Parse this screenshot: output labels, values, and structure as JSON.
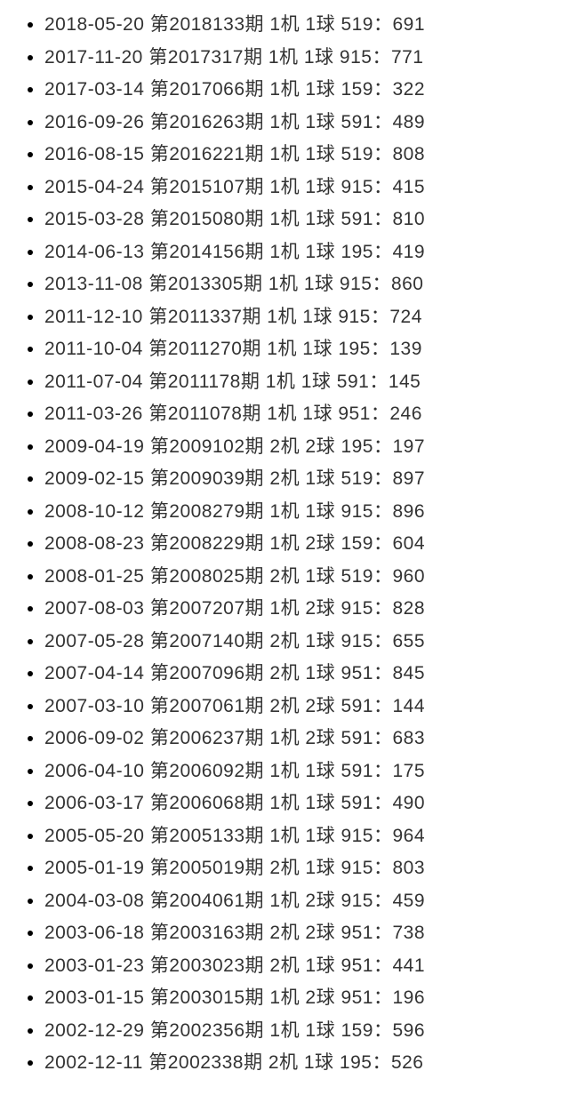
{
  "entries": [
    {
      "date": "2018-05-20",
      "issue": "2018133",
      "machine": "1",
      "ball": "1",
      "numA": "519",
      "numB": "691"
    },
    {
      "date": "2017-11-20",
      "issue": "2017317",
      "machine": "1",
      "ball": "1",
      "numA": "915",
      "numB": "771"
    },
    {
      "date": "2017-03-14",
      "issue": "2017066",
      "machine": "1",
      "ball": "1",
      "numA": "159",
      "numB": "322"
    },
    {
      "date": "2016-09-26",
      "issue": "2016263",
      "machine": "1",
      "ball": "1",
      "numA": "591",
      "numB": "489"
    },
    {
      "date": "2016-08-15",
      "issue": "2016221",
      "machine": "1",
      "ball": "1",
      "numA": "519",
      "numB": "808"
    },
    {
      "date": "2015-04-24",
      "issue": "2015107",
      "machine": "1",
      "ball": "1",
      "numA": "915",
      "numB": "415"
    },
    {
      "date": "2015-03-28",
      "issue": "2015080",
      "machine": "1",
      "ball": "1",
      "numA": "591",
      "numB": "810"
    },
    {
      "date": "2014-06-13",
      "issue": "2014156",
      "machine": "1",
      "ball": "1",
      "numA": "195",
      "numB": "419"
    },
    {
      "date": "2013-11-08",
      "issue": "2013305",
      "machine": "1",
      "ball": "1",
      "numA": "915",
      "numB": "860"
    },
    {
      "date": "2011-12-10",
      "issue": "2011337",
      "machine": "1",
      "ball": "1",
      "numA": "915",
      "numB": "724"
    },
    {
      "date": "2011-10-04",
      "issue": "2011270",
      "machine": "1",
      "ball": "1",
      "numA": "195",
      "numB": "139"
    },
    {
      "date": "2011-07-04",
      "issue": "2011178",
      "machine": "1",
      "ball": "1",
      "numA": "591",
      "numB": "145"
    },
    {
      "date": "2011-03-26",
      "issue": "2011078",
      "machine": "1",
      "ball": "1",
      "numA": "951",
      "numB": "246"
    },
    {
      "date": "2009-04-19",
      "issue": "2009102",
      "machine": "2",
      "ball": "2",
      "numA": "195",
      "numB": "197"
    },
    {
      "date": "2009-02-15",
      "issue": "2009039",
      "machine": "2",
      "ball": "1",
      "numA": "519",
      "numB": "897"
    },
    {
      "date": "2008-10-12",
      "issue": "2008279",
      "machine": "1",
      "ball": "1",
      "numA": "915",
      "numB": "896"
    },
    {
      "date": "2008-08-23",
      "issue": "2008229",
      "machine": "1",
      "ball": "2",
      "numA": "159",
      "numB": "604"
    },
    {
      "date": "2008-01-25",
      "issue": "2008025",
      "machine": "2",
      "ball": "1",
      "numA": "519",
      "numB": "960"
    },
    {
      "date": "2007-08-03",
      "issue": "2007207",
      "machine": "1",
      "ball": "2",
      "numA": "915",
      "numB": "828"
    },
    {
      "date": "2007-05-28",
      "issue": "2007140",
      "machine": "2",
      "ball": "1",
      "numA": "915",
      "numB": "655"
    },
    {
      "date": "2007-04-14",
      "issue": "2007096",
      "machine": "2",
      "ball": "1",
      "numA": "951",
      "numB": "845"
    },
    {
      "date": "2007-03-10",
      "issue": "2007061",
      "machine": "2",
      "ball": "2",
      "numA": "591",
      "numB": "144"
    },
    {
      "date": "2006-09-02",
      "issue": "2006237",
      "machine": "1",
      "ball": "2",
      "numA": "591",
      "numB": "683"
    },
    {
      "date": "2006-04-10",
      "issue": "2006092",
      "machine": "1",
      "ball": "1",
      "numA": "591",
      "numB": "175"
    },
    {
      "date": "2006-03-17",
      "issue": "2006068",
      "machine": "1",
      "ball": "1",
      "numA": "591",
      "numB": "490"
    },
    {
      "date": "2005-05-20",
      "issue": "2005133",
      "machine": "1",
      "ball": "1",
      "numA": "915",
      "numB": "964"
    },
    {
      "date": "2005-01-19",
      "issue": "2005019",
      "machine": "2",
      "ball": "1",
      "numA": "915",
      "numB": "803"
    },
    {
      "date": "2004-03-08",
      "issue": "2004061",
      "machine": "1",
      "ball": "2",
      "numA": "915",
      "numB": "459"
    },
    {
      "date": "2003-06-18",
      "issue": "2003163",
      "machine": "2",
      "ball": "2",
      "numA": "951",
      "numB": "738"
    },
    {
      "date": "2003-01-23",
      "issue": "2003023",
      "machine": "2",
      "ball": "1",
      "numA": "951",
      "numB": "441"
    },
    {
      "date": "2003-01-15",
      "issue": "2003015",
      "machine": "1",
      "ball": "2",
      "numA": "951",
      "numB": "196"
    },
    {
      "date": "2002-12-29",
      "issue": "2002356",
      "machine": "1",
      "ball": "1",
      "numA": "159",
      "numB": "596"
    },
    {
      "date": "2002-12-11",
      "issue": "2002338",
      "machine": "2",
      "ball": "1",
      "numA": "195",
      "numB": "526"
    }
  ],
  "labels": {
    "issue_prefix": "第",
    "issue_suffix": "期",
    "machine_suffix": "机",
    "ball_suffix": "球",
    "colon": "："
  }
}
